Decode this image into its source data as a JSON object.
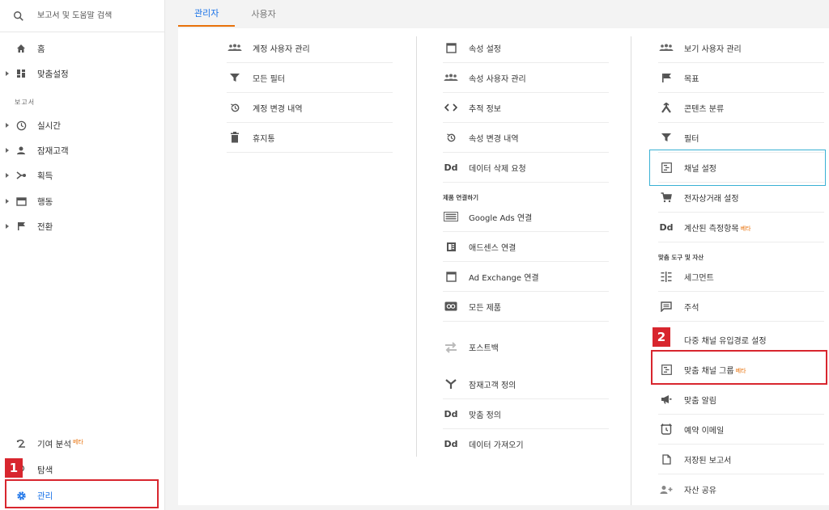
{
  "search": {
    "placeholder": "보고서 및 도움말 검색"
  },
  "sidebar": {
    "home": "홈",
    "customization": "맞춤설정",
    "reports_section": "보고서",
    "realtime": "실시간",
    "audience": "잠재고객",
    "acquisition": "획득",
    "behavior": "행동",
    "conversions": "전환",
    "attribution": "기여 분석",
    "attribution_badge": "베타",
    "discover": "탐색",
    "admin": "관리"
  },
  "tabs": {
    "admin": "관리자",
    "user": "사용자"
  },
  "account": {
    "items": [
      "계정 사용자 관리",
      "모든 필터",
      "계정 변경 내역",
      "휴지통"
    ]
  },
  "property": {
    "items": [
      "속성 설정",
      "속성 사용자 관리",
      "추적 정보",
      "속성 변경 내역",
      "데이터 삭제 요청"
    ],
    "linking_header": "제품 연결하기",
    "linking": [
      "Google Ads 연결",
      "애드센스 연결",
      "Ad Exchange 연결",
      "모든 제품"
    ],
    "other": [
      "포스트백",
      "잠재고객 정의",
      "맞춤 정의",
      "데이터 가져오기"
    ]
  },
  "view": {
    "items": [
      "보기 사용자 관리",
      "목표",
      "콘텐츠 분류",
      "필터",
      "채널 설정",
      "전자상거래 설정",
      "계산된 측정항목"
    ],
    "calc_badge": "베타",
    "tools_header": "맞춤 도구 및 자산",
    "tools": [
      "세그먼트",
      "주석",
      "다중 채널 유입경로 설정",
      "맞춤 채널 그룹",
      "맞춤 알림",
      "예약 이메일",
      "저장된 보고서",
      "자산 공유"
    ],
    "custom_group_badge": "베타"
  },
  "callouts": {
    "one": "1",
    "two": "2"
  },
  "colors": {
    "accent_blue": "#1a73e8",
    "tab_underline": "#e8710a",
    "callout_red": "#d8262e",
    "highlight_cyan": "#39b1d4"
  }
}
